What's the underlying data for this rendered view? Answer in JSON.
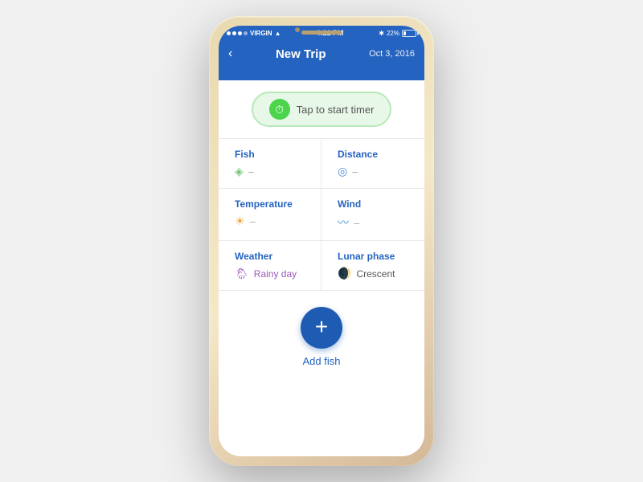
{
  "phone": {
    "status_bar": {
      "carrier": "VIRGIN",
      "time": "4:21 PM",
      "battery_pct": "22%"
    },
    "header": {
      "back_label": "‹",
      "title": "New Trip",
      "date": "Oct 3, 2016"
    },
    "timer": {
      "button_label": "Tap to start timer"
    },
    "stats": [
      {
        "label": "Fish",
        "icon": "🎣",
        "icon_class": "icon-fish",
        "value": "–",
        "value_colored": false
      },
      {
        "label": "Distance",
        "icon": "📍",
        "icon_class": "icon-distance",
        "value": "–",
        "value_colored": false
      },
      {
        "label": "Temperature",
        "icon": "☀",
        "icon_class": "icon-temp",
        "value": "–",
        "value_colored": false
      },
      {
        "label": "Wind",
        "icon": "〰",
        "icon_class": "icon-wind",
        "value": "–",
        "value_colored": false
      },
      {
        "label": "Weather",
        "icon": "🌦",
        "icon_class": "icon-weather",
        "value": "Rainy day",
        "value_colored": true
      },
      {
        "label": "Lunar phase",
        "icon": "🌒",
        "icon_class": "icon-lunar",
        "value": "Crescent",
        "value_colored": false
      }
    ],
    "add_fish": {
      "label": "Add fish"
    }
  }
}
